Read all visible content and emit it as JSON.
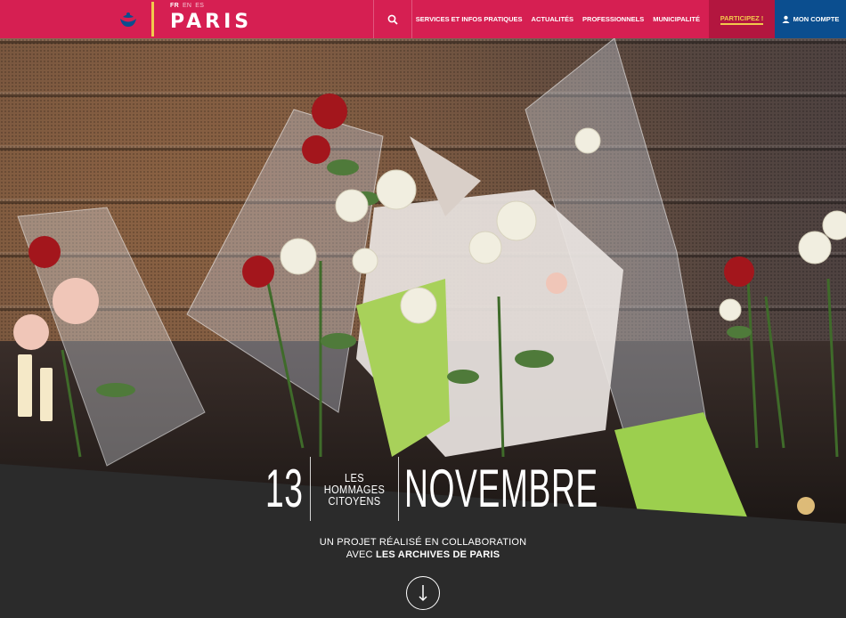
{
  "header": {
    "languages": [
      "FR",
      "EN",
      "ES"
    ],
    "brand": "PARIS",
    "nav": [
      "SERVICES ET INFOS PRATIQUES",
      "ACTUALITÉS",
      "PROFESSIONNELS",
      "MUNICIPALITÉ"
    ],
    "participez": "PARTICIPEZ !",
    "account": "MON COMPTE"
  },
  "hero": {
    "day": "13",
    "subtitle_lines": [
      "LES",
      "HOMMAGES",
      "CITOYENS"
    ],
    "month": "NOVEMBRE",
    "credit_line1": "UN PROJET RÉALISÉ EN COLLABORATION",
    "credit_line2_prefix": "AVEC",
    "credit_line2_highlight": "LES ARCHIVES DE PARIS"
  },
  "colors": {
    "brand_red": "#d61f52",
    "account_blue": "#0b4e8f",
    "accent_gold": "#f2c94c",
    "band_dark": "#2b2b2b"
  },
  "icons": [
    "paris-ship-logo-icon",
    "search-icon",
    "user-icon",
    "arrow-down-icon"
  ]
}
